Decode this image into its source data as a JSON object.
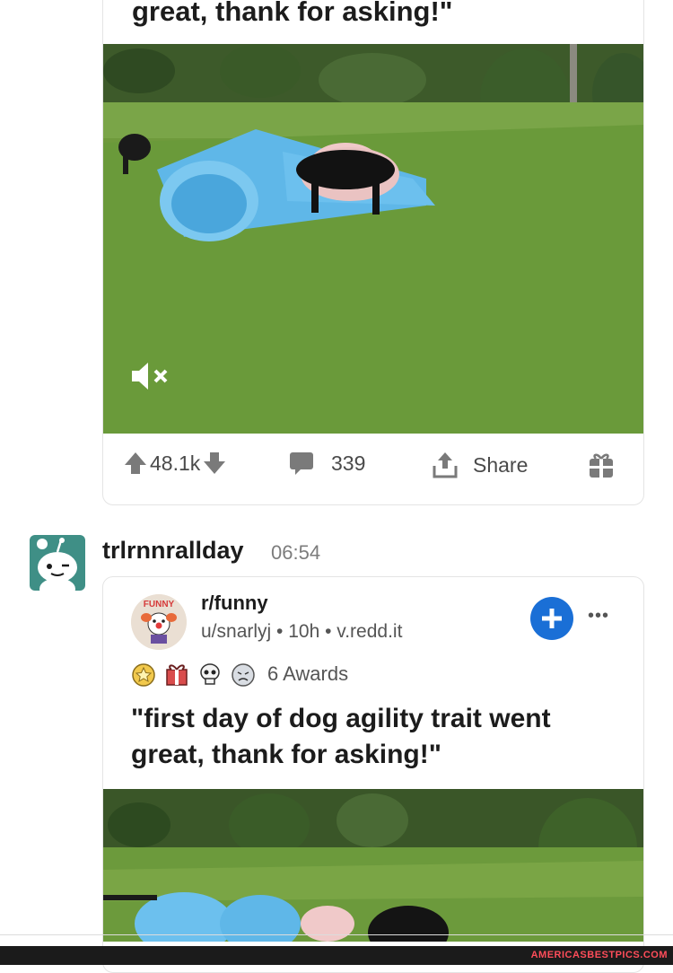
{
  "top_post": {
    "cut_title": "great, thank for asking!\"",
    "score": "48.1k",
    "comments": "339",
    "share_label": "Share"
  },
  "comment": {
    "username": "trlrnnrallday",
    "time": "06:54"
  },
  "shared_post": {
    "subreddit": "r/funny",
    "subreddit_icon_text": "FUNNY",
    "meta": "u/snarlyj • 10h • v.redd.it",
    "awards_label": "6 Awards",
    "title": "\"first day of dog agility trait went great, thank for asking!\""
  },
  "watermark": "AMERICASBESTPICS.COM",
  "colors": {
    "join_button": "#1a6fd6",
    "avatar_bg": "#3f8f86",
    "grass": "#6f9a3c",
    "tunnel": "#5fb7e8"
  }
}
